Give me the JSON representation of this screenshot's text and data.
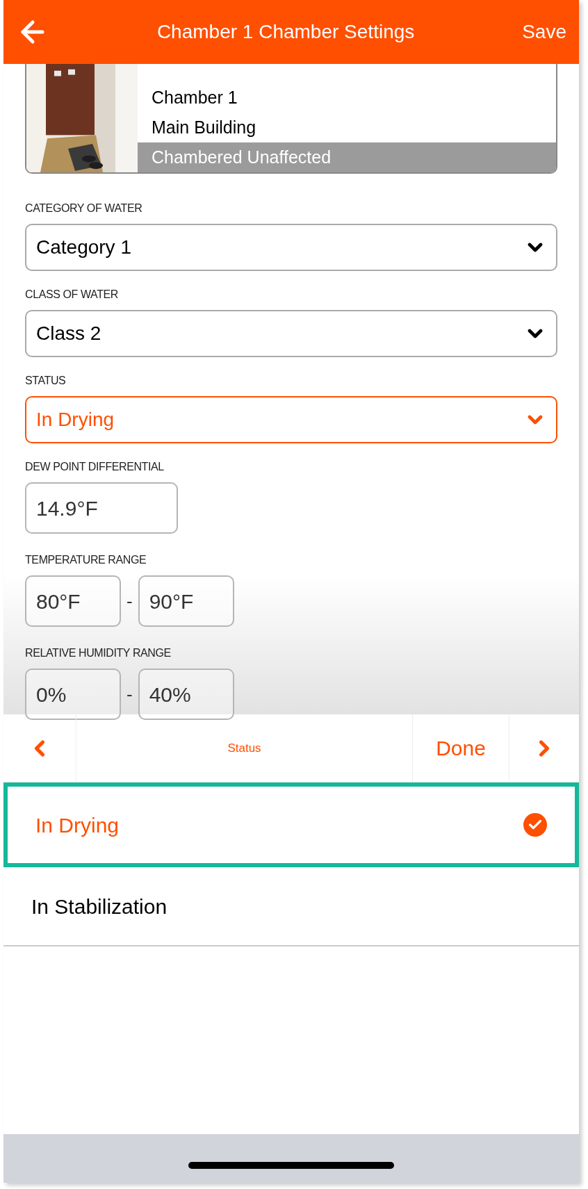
{
  "header": {
    "title": "Chamber 1 Chamber Settings",
    "save": "Save"
  },
  "location": {
    "items": [
      {
        "label": "Chamber 1",
        "selected": false
      },
      {
        "label": "Main Building",
        "selected": false
      },
      {
        "label": "Chambered Unaffected",
        "selected": true
      }
    ]
  },
  "selects": [
    {
      "label": "CATEGORY OF WATER",
      "value": "Category 1",
      "active": false
    },
    {
      "label": "CLASS OF WATER",
      "value": "Class 2",
      "active": false
    },
    {
      "label": "STATUS",
      "value": "In Drying",
      "active": true
    }
  ],
  "dew_point": {
    "label": "DEW POINT DIFFERENTIAL",
    "value": "14.9°F"
  },
  "ranges": [
    {
      "label": "TEMPERATURE RANGE",
      "from": "80°F",
      "separator": "-",
      "to": "90°F"
    },
    {
      "label": "RELATIVE HUMIDITY RANGE",
      "from": "0%",
      "separator": "-",
      "to": "40%"
    }
  ],
  "picker_toolbar": {
    "title": "Status",
    "done": "Done"
  },
  "options": [
    {
      "label": "In Drying",
      "selected": true
    },
    {
      "label": "In Stabilization",
      "selected": false
    }
  ]
}
